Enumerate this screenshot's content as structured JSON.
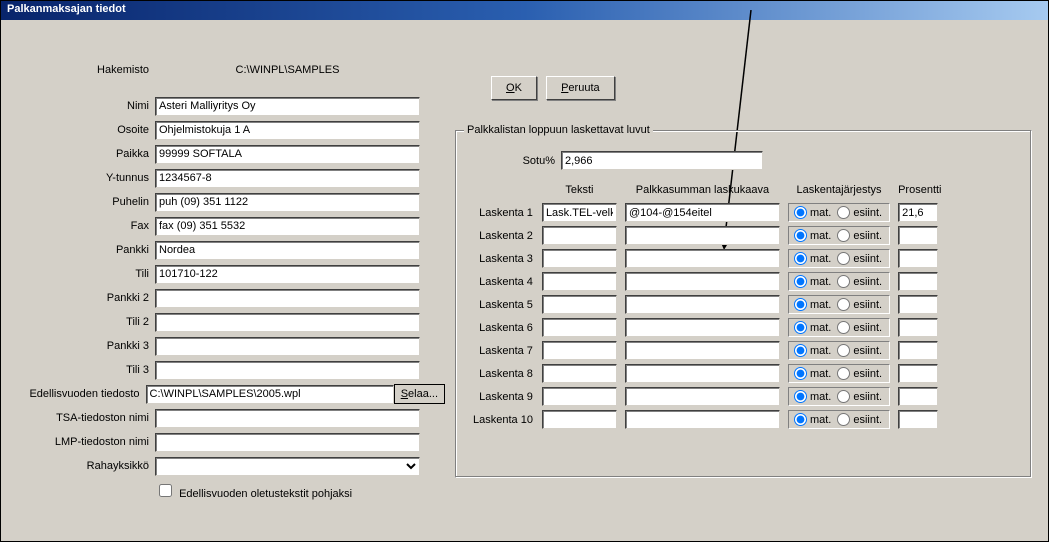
{
  "window_title": "Palkanmaksajan tiedot",
  "buttons": {
    "ok": "OK",
    "cancel": "Peruuta",
    "browse": "Selaa..."
  },
  "left": {
    "hakemisto_label": "Hakemisto",
    "hakemisto_value": "C:\\WINPL\\SAMPLES",
    "fields": {
      "nimi": {
        "label": "Nimi",
        "value": "Asteri Malliyritys Oy"
      },
      "osoite": {
        "label": "Osoite",
        "value": "Ohjelmistokuja 1 A"
      },
      "paikka": {
        "label": "Paikka",
        "value": "99999 SOFTALA"
      },
      "ytunnus": {
        "label": "Y-tunnus",
        "value": "1234567-8"
      },
      "puhelin": {
        "label": "Puhelin",
        "value": "puh (09) 351 1122"
      },
      "fax": {
        "label": "Fax",
        "value": "fax (09) 351 5532"
      },
      "pankki": {
        "label": "Pankki",
        "value": "Nordea"
      },
      "tili": {
        "label": "Tili",
        "value": "101710-122"
      },
      "pankki2": {
        "label": "Pankki 2",
        "value": ""
      },
      "tili2": {
        "label": "Tili 2",
        "value": ""
      },
      "pankki3": {
        "label": "Pankki 3",
        "value": ""
      },
      "tili3": {
        "label": "Tili 3",
        "value": ""
      },
      "edell": {
        "label": "Edellisvuoden tiedosto",
        "value": "C:\\WINPL\\SAMPLES\\2005.wpl"
      },
      "tsa": {
        "label": "TSA-tiedoston nimi",
        "value": ""
      },
      "lmp": {
        "label": "LMP-tiedoston nimi",
        "value": ""
      },
      "raha": {
        "label": "Rahayksikkö",
        "value": ""
      }
    },
    "checkbox_label": "Edellisvuoden oletustekstit pohjaksi"
  },
  "group": {
    "legend": "Palkkalistan loppuun laskettavat luvut",
    "sotu_label": "Sotu%",
    "sotu_value": "2,966",
    "headers": {
      "teksti": "Teksti",
      "kaava": "Palkkasumman laskukaava",
      "jarj": "Laskentajärjestys",
      "pros": "Prosentti"
    },
    "radio": {
      "mat": "mat.",
      "esiint": "esiint."
    },
    "rows": [
      {
        "label": "Laskenta 1",
        "teksti": "Lask.TEL-velka",
        "kaava": "@104-@154eitel",
        "pros": "21,6"
      },
      {
        "label": "Laskenta 2",
        "teksti": "",
        "kaava": "",
        "pros": ""
      },
      {
        "label": "Laskenta 3",
        "teksti": "",
        "kaava": "",
        "pros": ""
      },
      {
        "label": "Laskenta 4",
        "teksti": "",
        "kaava": "",
        "pros": ""
      },
      {
        "label": "Laskenta 5",
        "teksti": "",
        "kaava": "",
        "pros": ""
      },
      {
        "label": "Laskenta 6",
        "teksti": "",
        "kaava": "",
        "pros": ""
      },
      {
        "label": "Laskenta 7",
        "teksti": "",
        "kaava": "",
        "pros": ""
      },
      {
        "label": "Laskenta 8",
        "teksti": "",
        "kaava": "",
        "pros": ""
      },
      {
        "label": "Laskenta 9",
        "teksti": "",
        "kaava": "",
        "pros": ""
      },
      {
        "label": "Laskenta 10",
        "teksti": "",
        "kaava": "",
        "pros": ""
      }
    ]
  }
}
